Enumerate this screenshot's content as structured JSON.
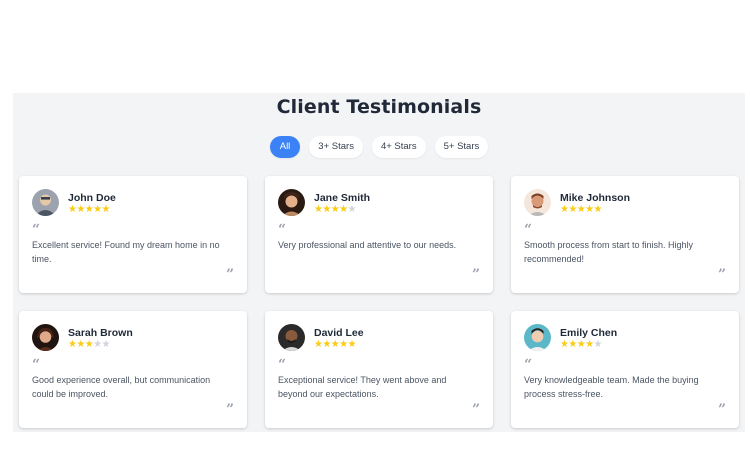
{
  "section": {
    "title": "Client Testimonials"
  },
  "filters": [
    "All",
    "3+ Stars",
    "4+ Stars",
    "5+ Stars"
  ],
  "active_filter": "All",
  "colors": {
    "accent": "#3b82f6",
    "star": "#facc15",
    "star_empty": "#d1d5db",
    "background": "#f3f4f6"
  },
  "icons": {
    "quote_open": "open-quote-icon",
    "quote_close": "close-quote-icon",
    "star": "star-icon"
  },
  "quote_open_glyph": "“",
  "quote_close_glyph": "”",
  "testimonials": [
    {
      "name": "John Doe",
      "rating": 5,
      "text": "Excellent service! Found my dream home in no time."
    },
    {
      "name": "Jane Smith",
      "rating": 4,
      "text": "Very professional and attentive to our needs."
    },
    {
      "name": "Mike Johnson",
      "rating": 5,
      "text": "Smooth process from start to finish. Highly recommended!"
    },
    {
      "name": "Sarah Brown",
      "rating": 3,
      "text": "Good experience overall, but communication could be improved."
    },
    {
      "name": "David Lee",
      "rating": 5,
      "text": "Exceptional service! They went above and beyond our expectations."
    },
    {
      "name": "Emily Chen",
      "rating": 4,
      "text": "Very knowledgeable team. Made the buying process stress-free."
    }
  ]
}
